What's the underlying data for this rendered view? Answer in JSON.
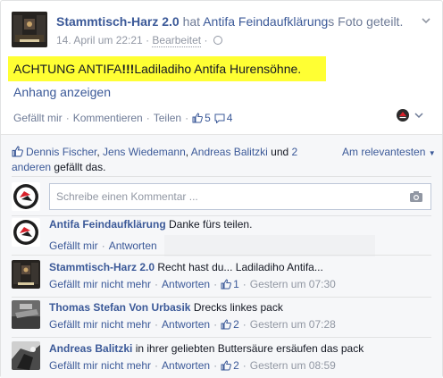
{
  "post": {
    "author": "Stammtisch-Harz 2.0",
    "shared_prefix": "hat",
    "shared_source": "Antifa Feindaufklärung",
    "shared_suffix": "s Foto geteilt.",
    "timestamp": "14. April um 22:21",
    "edited_label": "Bearbeitet",
    "text_before": "ACHTUNG ANTIFA",
    "text_bold": "!!!",
    "text_after": "Ladiladiho Antifa Hurensöhne.",
    "attachment_link": "Anhang anzeigen",
    "actions": {
      "like": "Gefällt mir",
      "comment": "Kommentieren",
      "share": "Teilen",
      "like_count": "5",
      "comment_count": "4"
    }
  },
  "likes": {
    "name1": "Dennis Fischer",
    "name2": "Jens Wiedemann",
    "name3": "Andreas Balitzki",
    "joiner": "und",
    "others": "2 anderen",
    "suffix": "gefällt das.",
    "sort_label": "Am relevantesten"
  },
  "composer": {
    "placeholder": "Schreibe einen Kommentar ..."
  },
  "comments": [
    {
      "author": "Antifa Feindaufklärung",
      "text": "Danke fürs teilen.",
      "like_label": "Gefällt mir",
      "reply_label": "Antworten"
    },
    {
      "author": "Stammtisch-Harz 2.0",
      "text": "Recht hast du... Ladiladiho Antifa...",
      "like_label": "Gefällt mir nicht mehr",
      "reply_label": "Antworten",
      "like_count": "1",
      "time": "Gestern um 07:30"
    },
    {
      "author": "Thomas Stefan Von Urbasik",
      "text": "Drecks linkes pack",
      "like_label": "Gefällt mir nicht mehr",
      "reply_label": "Antworten",
      "like_count": "2",
      "time": "Gestern um 07:28"
    },
    {
      "author": "Andreas Balitzki",
      "text": "in ihrer geliebten Buttersäure ersäufen das pack",
      "like_label": "Gefällt mir nicht mehr",
      "reply_label": "Antworten",
      "like_count": "2",
      "time": "Gestern um 08:59"
    }
  ],
  "colors": {
    "link": "#3b5998",
    "highlight": "#ffff33",
    "ufi_background": "#f6f7f9",
    "antifa_red": "#d8202a"
  },
  "icons": [
    "chevron-down-icon",
    "globe-icon",
    "thumbs-up-icon",
    "comment-bubble-icon",
    "antifa-flag-icon",
    "camera-icon",
    "page-switch-icon"
  ]
}
